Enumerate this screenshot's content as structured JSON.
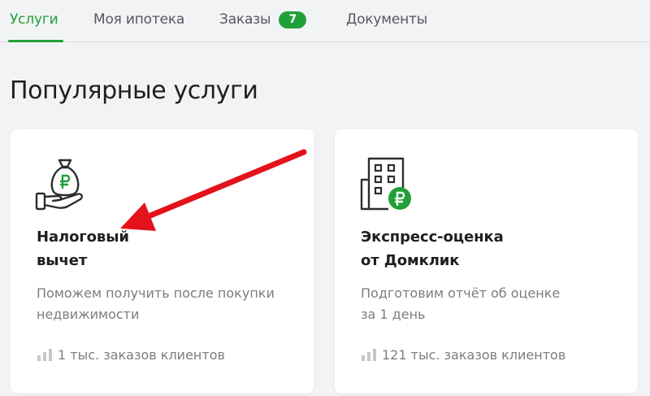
{
  "tabs": [
    {
      "label": "Услуги",
      "active": true
    },
    {
      "label": "Моя ипотека",
      "active": false
    },
    {
      "label": "Заказы",
      "active": false,
      "badge": "7"
    },
    {
      "label": "Документы",
      "active": false
    }
  ],
  "page_title": "Популярные услуги",
  "cards": [
    {
      "icon": "money-bag-hand-icon",
      "title_lines": [
        "Налоговый",
        "вычет"
      ],
      "desc_lines": [
        "Поможем получить после покупки",
        "недвижимости"
      ],
      "stat": "1 тыс. заказов клиентов"
    },
    {
      "icon": "building-ruble-icon",
      "title_lines": [
        "Экспресс-оценка",
        "от Домклик"
      ],
      "desc_lines": [
        "Подготовим отчёт об оценке",
        "за 1 день"
      ],
      "stat": "121 тыс. заказов клиентов"
    }
  ],
  "colors": {
    "accent": "#21a038",
    "background": "#f2f3f5",
    "card": "#ffffff",
    "muted_text": "#7a7d82",
    "annotation_arrow": "#e3121b"
  }
}
